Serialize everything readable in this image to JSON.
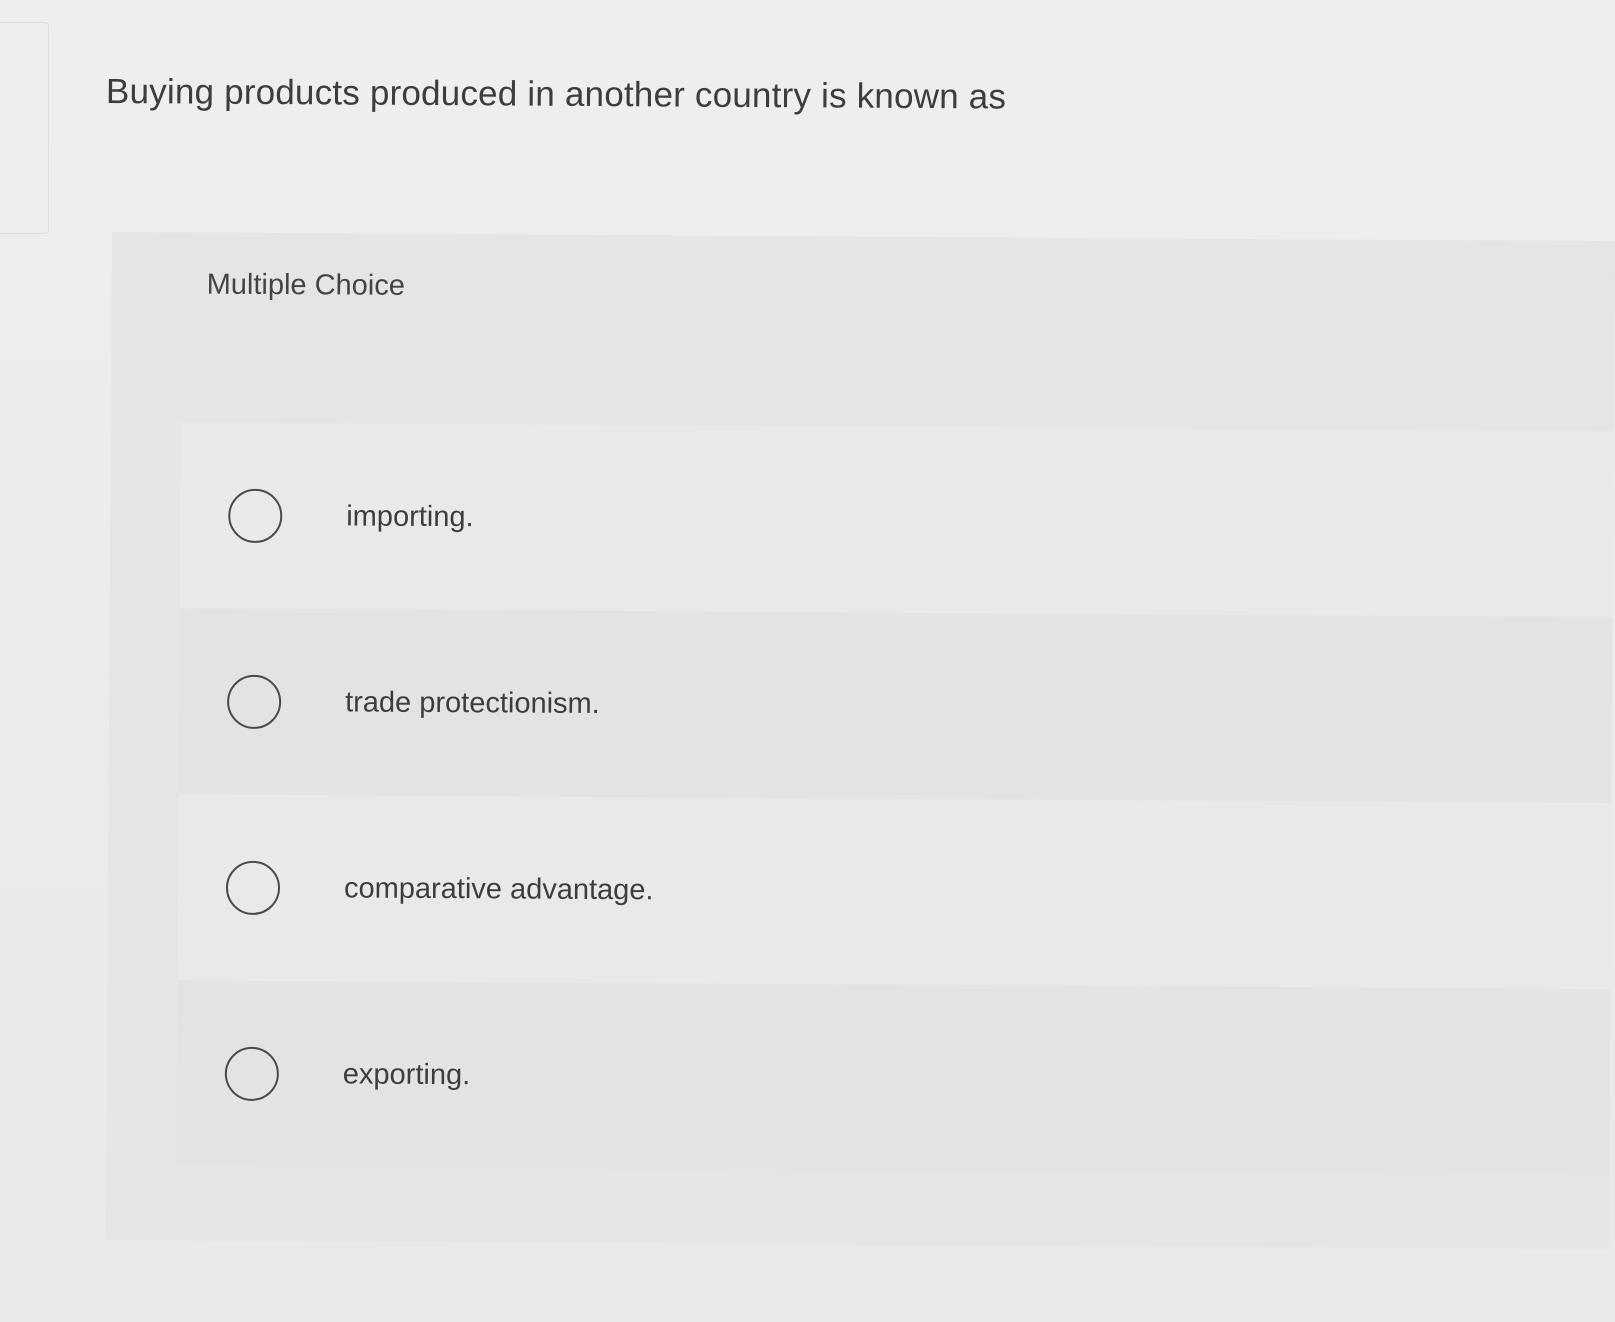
{
  "question": {
    "text": "Buying products produced in another country is known as"
  },
  "section": {
    "label": "Multiple Choice"
  },
  "options": [
    {
      "label": "importing.",
      "selected": false
    },
    {
      "label": "trade protectionism.",
      "selected": false
    },
    {
      "label": "comparative advantage.",
      "selected": false
    },
    {
      "label": "exporting.",
      "selected": false
    }
  ]
}
